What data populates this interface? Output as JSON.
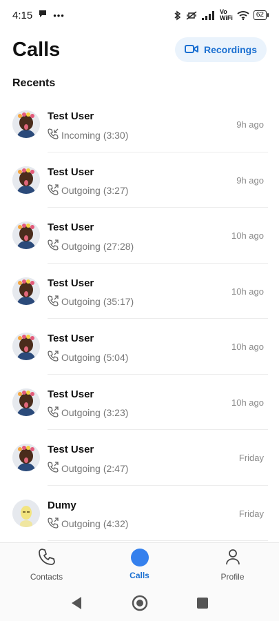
{
  "status_bar": {
    "time": "4:15",
    "volte_top": "Vo",
    "volte_bottom": "WiFi",
    "battery": "62"
  },
  "header": {
    "title": "Calls",
    "recordings_label": "Recordings"
  },
  "section_title": "Recents",
  "calls": [
    {
      "name": "Test User",
      "direction": "Incoming",
      "duration": "(3:30)",
      "time": "9h ago",
      "avatar": "avatar-test-user"
    },
    {
      "name": "Test User",
      "direction": "Outgoing",
      "duration": "(3:27)",
      "time": "9h ago",
      "avatar": "avatar-test-user"
    },
    {
      "name": "Test User",
      "direction": "Outgoing",
      "duration": "(27:28)",
      "time": "10h ago",
      "avatar": "avatar-test-user"
    },
    {
      "name": "Test User",
      "direction": "Outgoing",
      "duration": "(35:17)",
      "time": "10h ago",
      "avatar": "avatar-test-user"
    },
    {
      "name": "Test User",
      "direction": "Outgoing",
      "duration": "(5:04)",
      "time": "10h ago",
      "avatar": "avatar-test-user"
    },
    {
      "name": "Test User",
      "direction": "Outgoing",
      "duration": "(3:23)",
      "time": "10h ago",
      "avatar": "avatar-test-user"
    },
    {
      "name": "Test User",
      "direction": "Outgoing",
      "duration": "(2:47)",
      "time": "Friday",
      "avatar": "avatar-test-user"
    },
    {
      "name": "Dumy",
      "direction": "Outgoing",
      "duration": "(4:32)",
      "time": "Friday",
      "avatar": "avatar-dumy"
    }
  ],
  "tabs": [
    {
      "label": "Contacts",
      "icon": "phone-icon",
      "active": false
    },
    {
      "label": "Calls",
      "icon": "calls-dot-icon",
      "active": true
    },
    {
      "label": "Profile",
      "icon": "person-icon",
      "active": false
    }
  ],
  "colors": {
    "accent": "#1a6fd1",
    "accent_bg": "#eaf3fc",
    "active_dot": "#3580ed"
  }
}
